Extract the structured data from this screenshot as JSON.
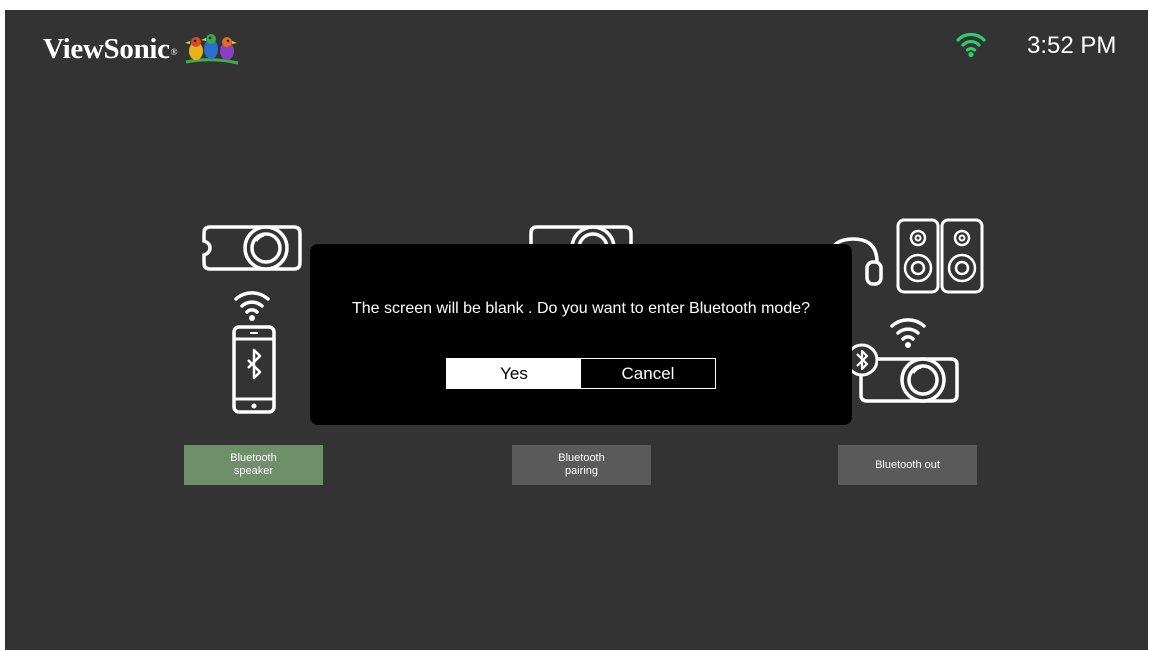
{
  "header": {
    "brand_name": "ViewSonic",
    "brand_mark": "®",
    "brand_logo_icon": "birds-logo-icon",
    "wifi_icon": "wifi-icon",
    "clock": "3:52 PM"
  },
  "modes": [
    {
      "label": "Bluetooth speaker",
      "selected": true,
      "icons": [
        "projector-icon",
        "wifi-icon",
        "smartphone-bluetooth-icon"
      ]
    },
    {
      "label": "Bluetooth pairing",
      "selected": false,
      "icons": [
        "projector-icon"
      ]
    },
    {
      "label": "Bluetooth out",
      "selected": false,
      "icons": [
        "headphones-icon",
        "speakers-icon",
        "wifi-icon",
        "bluetooth-icon",
        "projector-icon"
      ]
    }
  ],
  "dialog": {
    "message": "The screen will be blank . Do you want to enter Bluetooth mode?",
    "yes_label": "Yes",
    "cancel_label": "Cancel",
    "focused": "Yes"
  },
  "colors": {
    "background": "#333333",
    "selected_button": "#6e8f6a",
    "button": "#5a5a5a",
    "wifi_status": "#2ecc71"
  }
}
